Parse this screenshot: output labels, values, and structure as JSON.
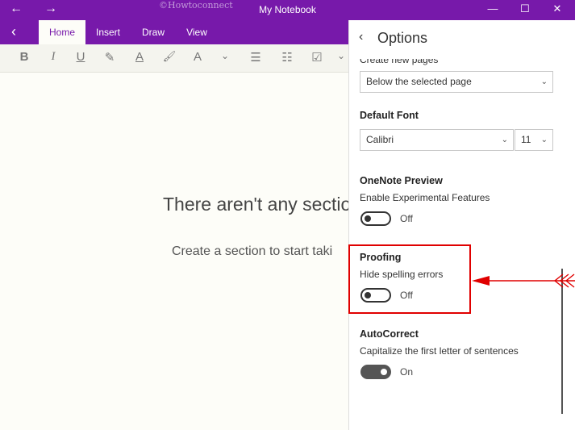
{
  "window": {
    "title": "My Notebook",
    "watermark": "©Howtoconnect",
    "nav_back": "←",
    "nav_forward": "→",
    "minimize": "—",
    "maximize": "☐",
    "close": "✕"
  },
  "ribbon": {
    "back": "‹",
    "tabs": [
      "Home",
      "Insert",
      "Draw",
      "View"
    ],
    "active_tab": "Home"
  },
  "toolbar": {
    "bold": "B",
    "italic": "I",
    "underline": "U",
    "highlight": "✎",
    "font_color": "A",
    "format_painter": "🖌",
    "clear_format": "A",
    "more": "⌄",
    "bullets": "☰",
    "numbering": "☷",
    "checkbox": "☑",
    "more2": "⌄"
  },
  "main": {
    "empty_title": "There aren't any sectio",
    "empty_sub": "Create a section to start taki"
  },
  "options": {
    "back": "‹",
    "title": "Options",
    "partial_label": "Create new pages",
    "new_pages_select": "Below the selected page",
    "default_font_label": "Default Font",
    "font_name": "Calibri",
    "font_size": "11",
    "preview": {
      "heading": "OneNote Preview",
      "label": "Enable Experimental Features",
      "state": "Off"
    },
    "proofing": {
      "heading": "Proofing",
      "label": "Hide spelling errors",
      "state": "Off"
    },
    "autocorrect": {
      "heading": "AutoCorrect",
      "label": "Capitalize the first letter of sentences",
      "state": "On"
    }
  },
  "colors": {
    "accent": "#7719aa",
    "annotation": "#e00000"
  }
}
